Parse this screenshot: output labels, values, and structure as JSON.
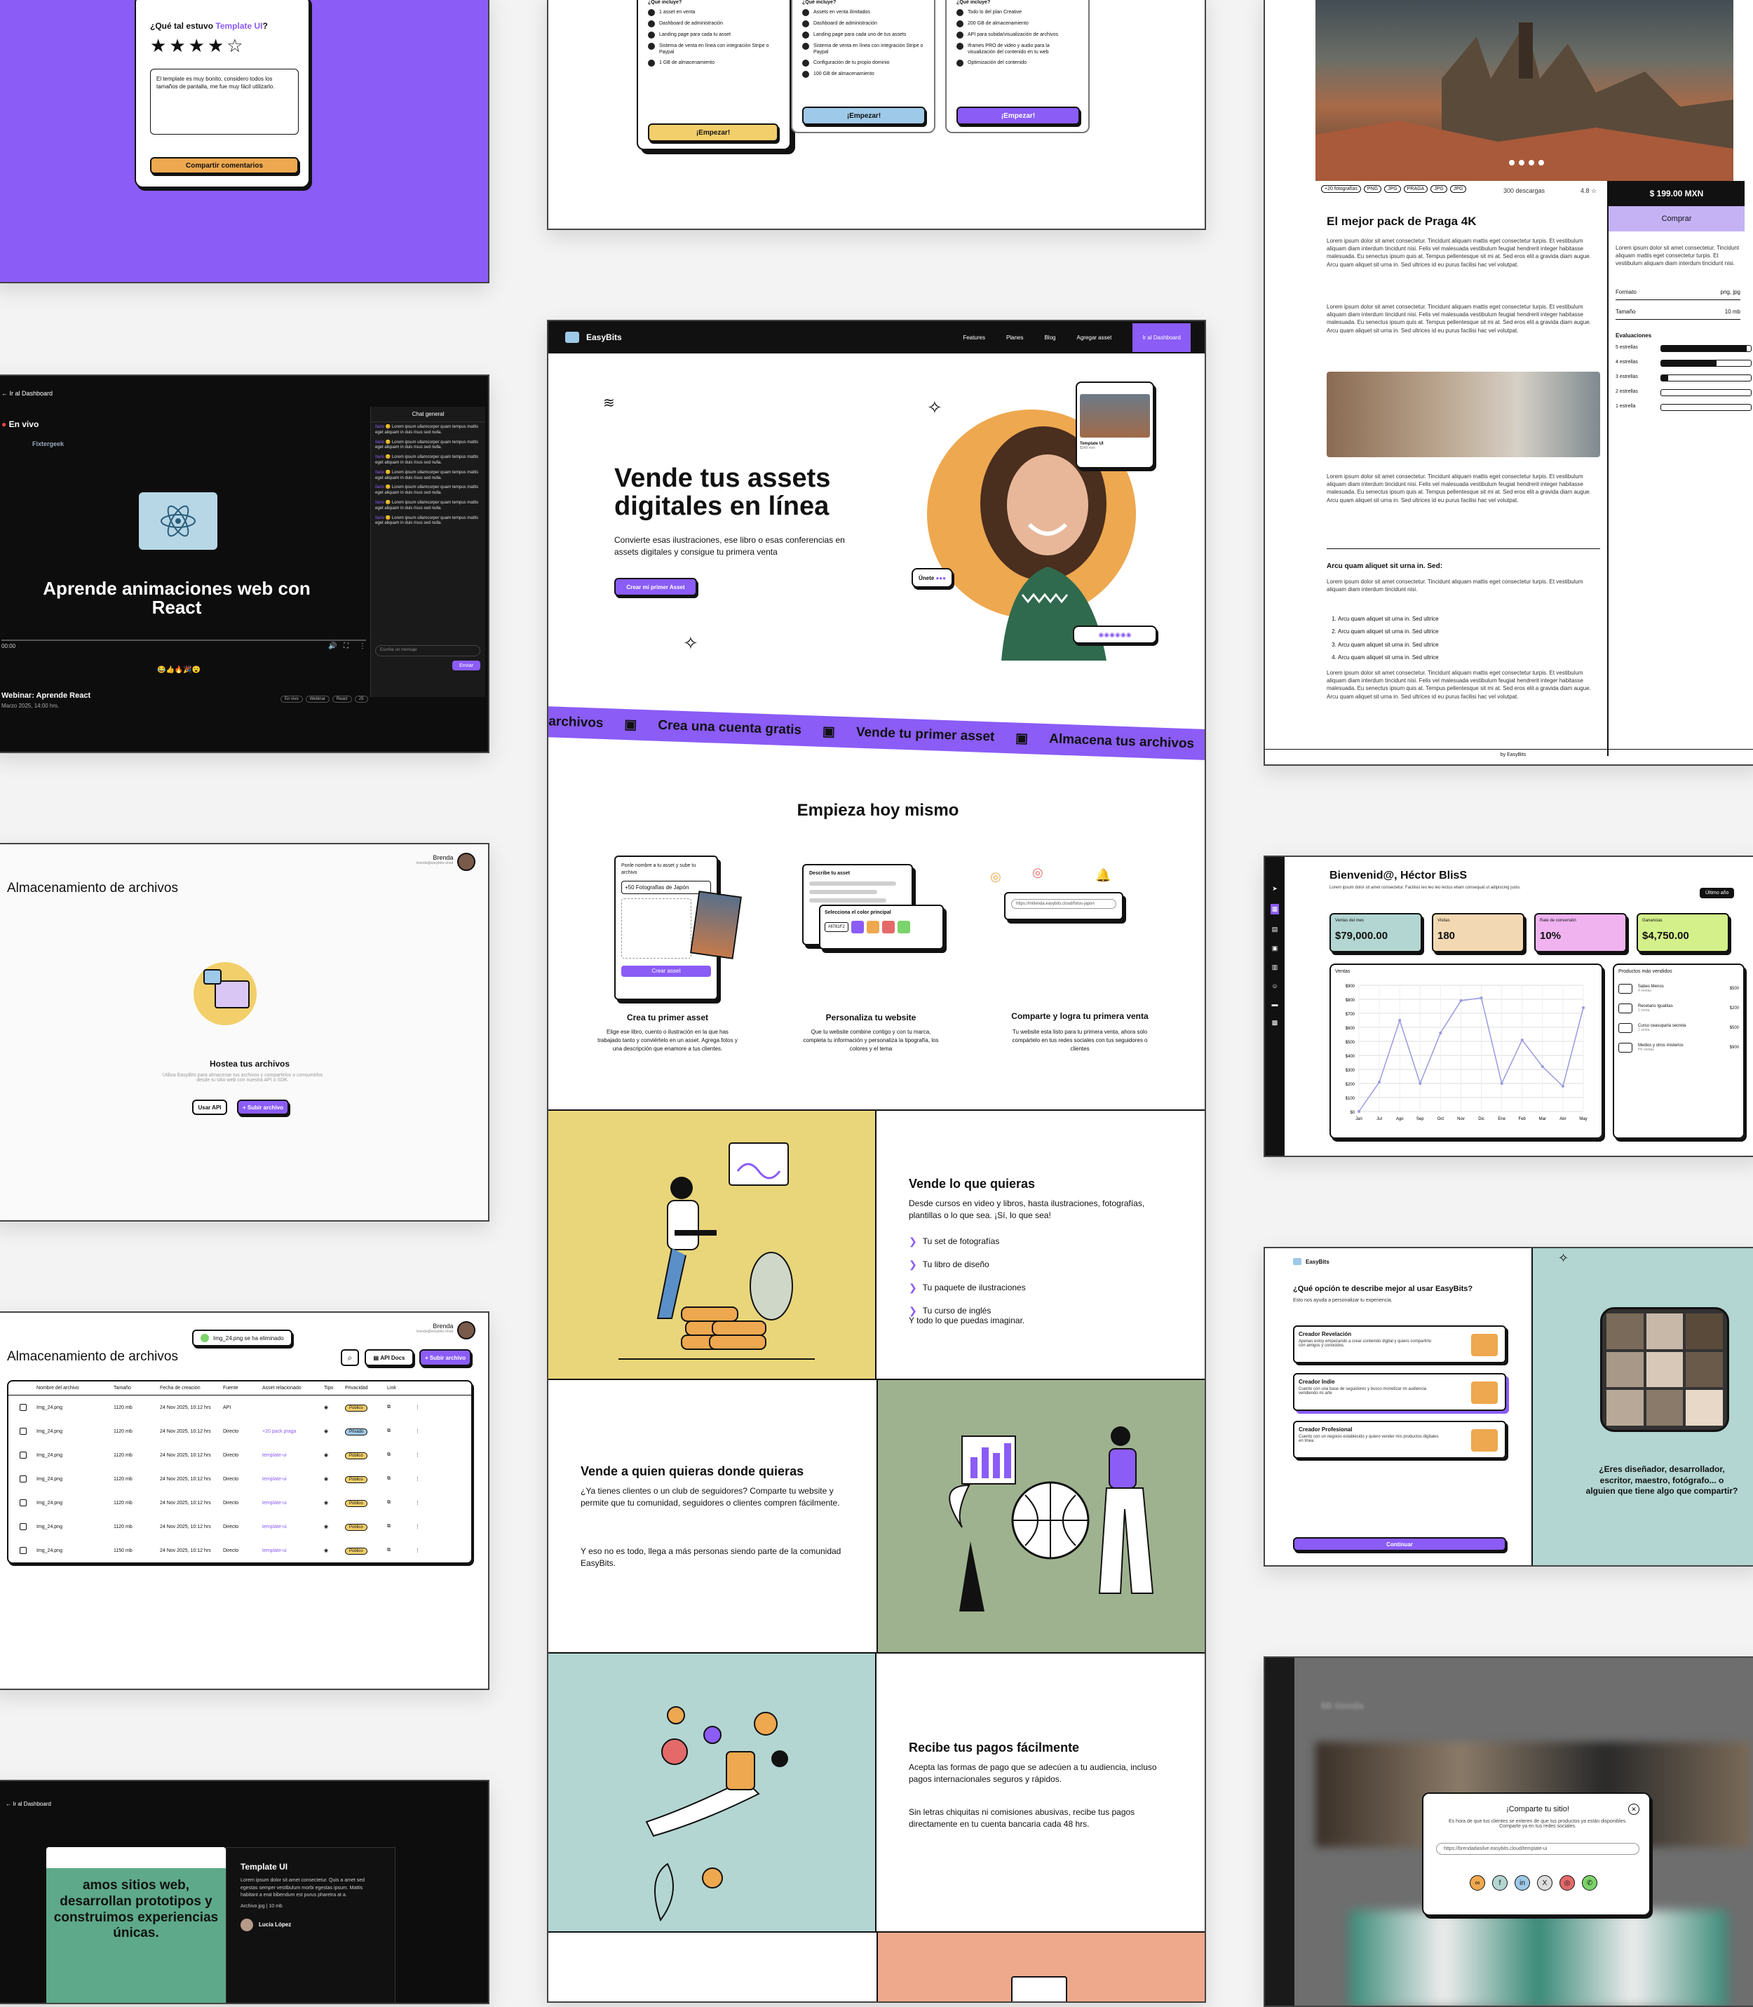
{
  "rating": {
    "question_prefix": "¿Qué tal estuvo",
    "question_highlight": "Template UI",
    "question_suffix": "?",
    "stars": 4,
    "comment": "El template es muy bonito, considero todos los tamaños de pantalla, me fue muy fácil utilizarlo.",
    "button": "Compartir comentarios"
  },
  "pricing": {
    "heading": "¿Qué incluye?",
    "plans": [
      {
        "features": [
          "1 asset en venta",
          "Dashboard de administración",
          "Landing page para cada tu asset",
          "Sistema de venta en línea con integración Stripe o Paypal",
          "1 GB de almacenamiento"
        ],
        "button": "¡Empezar!",
        "color": "#f2cf6a"
      },
      {
        "features": [
          "Assets en venta ilimitados",
          "Dashboard de administración",
          "Landing page para cada uno de tus assets",
          "Sistema de venta en línea con integración Stripe o Paypal",
          "Configuración de tu propio dominio",
          "100 GB de almacenamiento"
        ],
        "button": "¡Empezar!",
        "color": "#9ec9e8"
      },
      {
        "features": [
          "Todo lo del plan Creative",
          "200 GB de almacenamiento",
          "API para subida/visualización de archivos",
          "Iframes PRO de video y audio para la visualización del contenido en tu web",
          "Optimización del contenido"
        ],
        "button": "¡Empezar!",
        "color": "#8b5cf6"
      }
    ]
  },
  "product": {
    "tags": [
      "+20 fotografías",
      "PNG",
      "JPG",
      "PRAGA",
      "JPG",
      "JPG"
    ],
    "downloads": "300 descargas",
    "rating": "4.8",
    "price": "$ 199.00 MXN",
    "buy": "Comprar",
    "title": "El mejor pack de Praga 4K",
    "lorem": "Lorem ipsum dolor sit amet consectetur. Tincidunt aliquam mattis eget consectetur turpis. Et vestibulum aliquam diam interdum tincidunt nisi. Felis vel malesuada vestibulum feugiat hendrerit integer habitasse malesuada. Eu senectus ipsum quis at. Tempus pellentesque sit mi at. Sed eros elit a gravida diam augue. Arcu quam aliquet sit urna in. Sed ultrices id eu purus facilisi hac vel volutpat.",
    "side_text": "Lorem ipsum dolor sit amet consectetur. Tincidunt aliquam mattis eget consectetur turpis. Et vestibulum aliquam diam interdum tincidunt nisi.",
    "format_label": "Formato",
    "format_value": "png, jpg",
    "size_label": "Tamaño",
    "size_value": "10 mb",
    "reviews_label": "Evaluaciones",
    "reviews": [
      {
        "label": "5 estrellas",
        "value": 0.95
      },
      {
        "label": "4 estrellas",
        "value": 0.62
      },
      {
        "label": "3 estrellas",
        "value": 0.08
      },
      {
        "label": "2 estrellas",
        "value": 0
      },
      {
        "label": "1 estrella",
        "value": 0
      }
    ],
    "subheading": "Arcu quam aliquet sit urna in. Sed:",
    "list": [
      "Arcu quam aliquet sit urna in. Sed ultrice",
      "Arcu quam aliquet sit urna in. Sed ultrice",
      "Arcu quam aliquet sit urna in. Sed ultrice",
      "Arcu quam aliquet sit urna in. Sed ultrice"
    ],
    "footer": "by EasyBits"
  },
  "webinar": {
    "back": "Ir al Dashboard",
    "live": "En vivo",
    "brand": "Fixtergeek",
    "video_title": "Aprende animaciones web con React",
    "time": "00:00",
    "chat_title": "Chat general",
    "chat_msg": "Lorem ipsum ullamcorper quam tempus mattis eget aliquam in duis risus sed nulla.",
    "chat_user": "Ilario",
    "chat_placeholder": "Escribe un mensaje",
    "send": "Enviar",
    "reactions": "😂👍🔥🎉😮",
    "name": "Webinar: Aprende React",
    "date": "Marzo 2025, 14:00 hrs.",
    "tags": [
      "En vivo",
      "Webinar",
      "React",
      "JS"
    ]
  },
  "nav": {
    "logo": "EasyBits",
    "links": [
      "Features",
      "Planes",
      "Blog",
      "Agregar asset"
    ],
    "cta": "Ir al Dashboard"
  },
  "hero": {
    "title_1": "Vende tus assets",
    "title_2": "digitales en línea",
    "subtitle": "Convierte esas ilustraciones, ese libro o esas conferencias en assets digitales y consigue tu primera venta",
    "button": "Crear mi primer Asset",
    "card_title": "Template UI",
    "card_price": "$349 mxn",
    "join": "Únete"
  },
  "marquee": [
    "archivos",
    "Crea una cuenta gratis",
    "Vende tu primer asset",
    "Almacena tus archivos"
  ],
  "start": {
    "heading": "Empieza hoy mismo",
    "steps": [
      {
        "mock_title": "Ponle nombre a tu asset y sube tu archivo",
        "mock_input": "+50 Fotografías de Japón",
        "mock_button": "Crear asset",
        "title": "Crea tu primer asset",
        "text": "Elige ese libro, cuento o ilustración en la que has trabajado tanto y conviértelo en un asset. Agrega fotos y una descripción que enamore a tus clientes."
      },
      {
        "mock_title": "Describe tu asset",
        "mock_color": "Selecciona el color principal",
        "mock_hex": "#8781F2",
        "title": "Personaliza tu website",
        "text": "Que tu website combine contigo y con tu marca, completa tu información y personaliza la tipografía, los colores y el tema"
      },
      {
        "mock_url": "https://mitienda.easybits.cloud/fotos-japon",
        "title": "Comparte y logra tu primera venta",
        "text": "Tu website esta listo para tu primera venta, ahora solo compártelo en tus redes sociales con tus seguidores o clientes"
      }
    ]
  },
  "features": [
    {
      "title": "Vende lo que quieras",
      "text": "Desde cursos en video y libros, hasta ilustraciones, fotografías, plantillas o lo que sea. ¡Sí, lo que sea!",
      "list": [
        "Tu set de fotografías",
        "Tu libro de diseño",
        "Tu paquete de ilustraciones",
        "Tu curso de inglés"
      ],
      "extra": "Y todo lo que puedas imaginar."
    },
    {
      "title": "Vende a quien quieras donde quieras",
      "text": "¿Ya tienes clientes o un club de seguidores? Comparte tu website y permite que tu comunidad, seguidores o clientes compren fácilmente.",
      "extra": "Y eso no es todo, llega a más personas siendo parte de la comunidad EasyBits."
    },
    {
      "title": "Recibe tus pagos fácilmente",
      "text": "Acepta las formas de pago que se adecúen a tu audiencia, incluso pagos internacionales seguros y rápidos.",
      "extra": "Sin letras chiquitas ni comisiones abusivas, recibe tus pagos directamente en tu cuenta bancaria cada 48 hrs."
    }
  ],
  "colors": {
    "purple": "#8b5cf6",
    "yellow": "#e9d67a",
    "green": "#9fb28f",
    "teal": "#b3d6d2",
    "salmon": "#eea98c",
    "orange": "#eea84f"
  },
  "storage": {
    "title": "Almacenamiento de archivos",
    "user": "Brenda",
    "user_email": "brenda@easybits.cloud",
    "empty_title": "Hostea tus archivos",
    "empty_text": "Utiliza EasyBits para almacenar tus archivos y compartirlos o consumirlos desde tu sitio web con nuestra API o SDK.",
    "api_button": "Usar API",
    "upload_button": "+ Subir archivo"
  },
  "table": {
    "toast": "Img_24.png se ha eliminado",
    "api_docs": "API Docs",
    "upload": "+ Subir archivo",
    "columns": [
      "Nombre del archivo",
      "Tamaño",
      "Fecha de creación",
      "Fuente",
      "Asset relacionado",
      "Tipo",
      "Privacidad",
      "Link"
    ],
    "rows": [
      {
        "name": "Img_24.png",
        "size": "1120 mb",
        "date": "24 Nov 2025, 10:12 hrs",
        "source": "API",
        "asset": "",
        "privacy": "Público"
      },
      {
        "name": "Img_24.png",
        "size": "1120 mb",
        "date": "24 Nov 2025, 10:12 hrs",
        "source": "Directo",
        "asset": "+20 pack praga",
        "privacy": "Privado"
      },
      {
        "name": "Img_24.png",
        "size": "1120 mb",
        "date": "24 Nov 2025, 10:12 hrs",
        "source": "Directo",
        "asset": "template-ui",
        "privacy": "Público"
      },
      {
        "name": "Img_24.png",
        "size": "1120 mb",
        "date": "24 Nov 2025, 10:12 hrs",
        "source": "Directo",
        "asset": "template-ui",
        "privacy": "Público"
      },
      {
        "name": "Img_24.png",
        "size": "1120 mb",
        "date": "24 Nov 2025, 10:12 hrs",
        "source": "Directo",
        "asset": "template-ui",
        "privacy": "Público"
      },
      {
        "name": "Img_24.png",
        "size": "1120 mb",
        "date": "24 Nov 2025, 10:12 hrs",
        "source": "Directo",
        "asset": "template-ui",
        "privacy": "Público"
      },
      {
        "name": "Img_24.png",
        "size": "1150 mb",
        "date": "24 Nov 2025, 10:12 hrs",
        "source": "Directo",
        "asset": "template-ui",
        "privacy": "Público"
      }
    ]
  },
  "template_page": {
    "back": "Ir al Dashboard",
    "hero_text": "amos sitios web, desarrollan prototipos y construimos experiencias únicas.",
    "title": "Template UI",
    "text": "Lorem ipsum dolor sit amet consectetur. Quis a amet sed egestas semper vestibulum morbi egestas ipsum. Mattis habitant a erat bibendum est purus pharetra at a.",
    "file": "Archivo jpg | 10 mb",
    "author": "Lucía López"
  },
  "dashboard": {
    "greeting": "Bienvenid@, Héctor BlisS",
    "intro": "Lorem ipsum dolor sit amet consectetur. Facilisis leo leo leo lectus etiam consequat ut adipiscing justo.",
    "period": "Último año",
    "stats": [
      {
        "label": "Ventas del mes",
        "value": "$79,000.00",
        "color": "#b3d6d2"
      },
      {
        "label": "Visitas",
        "value": "180",
        "color": "#f3d9b3"
      },
      {
        "label": "Rate de conversión",
        "value": "10%",
        "color": "#f0b3f0"
      },
      {
        "label": "Ganancias",
        "value": "$4,750.00",
        "color": "#d4f08a"
      }
    ],
    "chart_title": "Ventas",
    "top_title": "Productos más vendidos",
    "top": [
      {
        "name": "Sabes Menos",
        "sub": "4 ventas",
        "price": "$500"
      },
      {
        "name": "Recetario Igualitas",
        "sub": "1 venta",
        "price": "$200"
      },
      {
        "name": "Curso ceasuparla secreta",
        "sub": "1 venta",
        "price": "$500"
      },
      {
        "name": "Medios y otros misterios",
        "sub": "PK ventas",
        "price": "$900"
      }
    ]
  },
  "chart_data": {
    "type": "line",
    "title": "Ventas",
    "categories": [
      "Jan",
      "Jul",
      "Ago",
      "Sep",
      "Oct",
      "Nov",
      "Dic",
      "Ene",
      "Feb",
      "Mar",
      "Abr",
      "May"
    ],
    "values": [
      0,
      210,
      650,
      200,
      560,
      790,
      810,
      200,
      510,
      320,
      180,
      740
    ],
    "yticks": [
      "$0",
      "$100",
      "$200",
      "$300",
      "$400",
      "$500",
      "$600",
      "$700",
      "$800",
      "$900"
    ],
    "ylim": [
      0,
      900
    ]
  },
  "onboarding": {
    "logo": "EasyBits",
    "question": "¿Qué opción te describe mejor al usar EasyBits?",
    "hint": "Esto nos ayuda a personalizar tu experiencia.",
    "options": [
      {
        "title": "Creador Revelación",
        "text": "Apenas estoy empezando a crear contenido digital y quiero compartirlo con amigos y conocidos."
      },
      {
        "title": "Creador Indie",
        "text": "Cuento con una base de seguidores y busco monetizar mi audiencia vendiendo mi arte"
      },
      {
        "title": "Creador Profesional",
        "text": "Cuento con un negocio establecido y quiero vender mis productos digitales en línea"
      }
    ],
    "button": "Continuar",
    "side_text": "¿Eres diseñador, desarrollador, escritor, maestro, fotógrafo... o alguien que tiene algo que compartir?"
  },
  "share": {
    "title": "¡Comparte tu sitio!",
    "text": "Es hora de que tus clientes se enteren de que tus productos ya están disponibles. Comparte ya en tus redes sociales.",
    "url": "https://brendadasilve.easybits.cloud/template-ui",
    "blur_title": "Mi tienda"
  }
}
